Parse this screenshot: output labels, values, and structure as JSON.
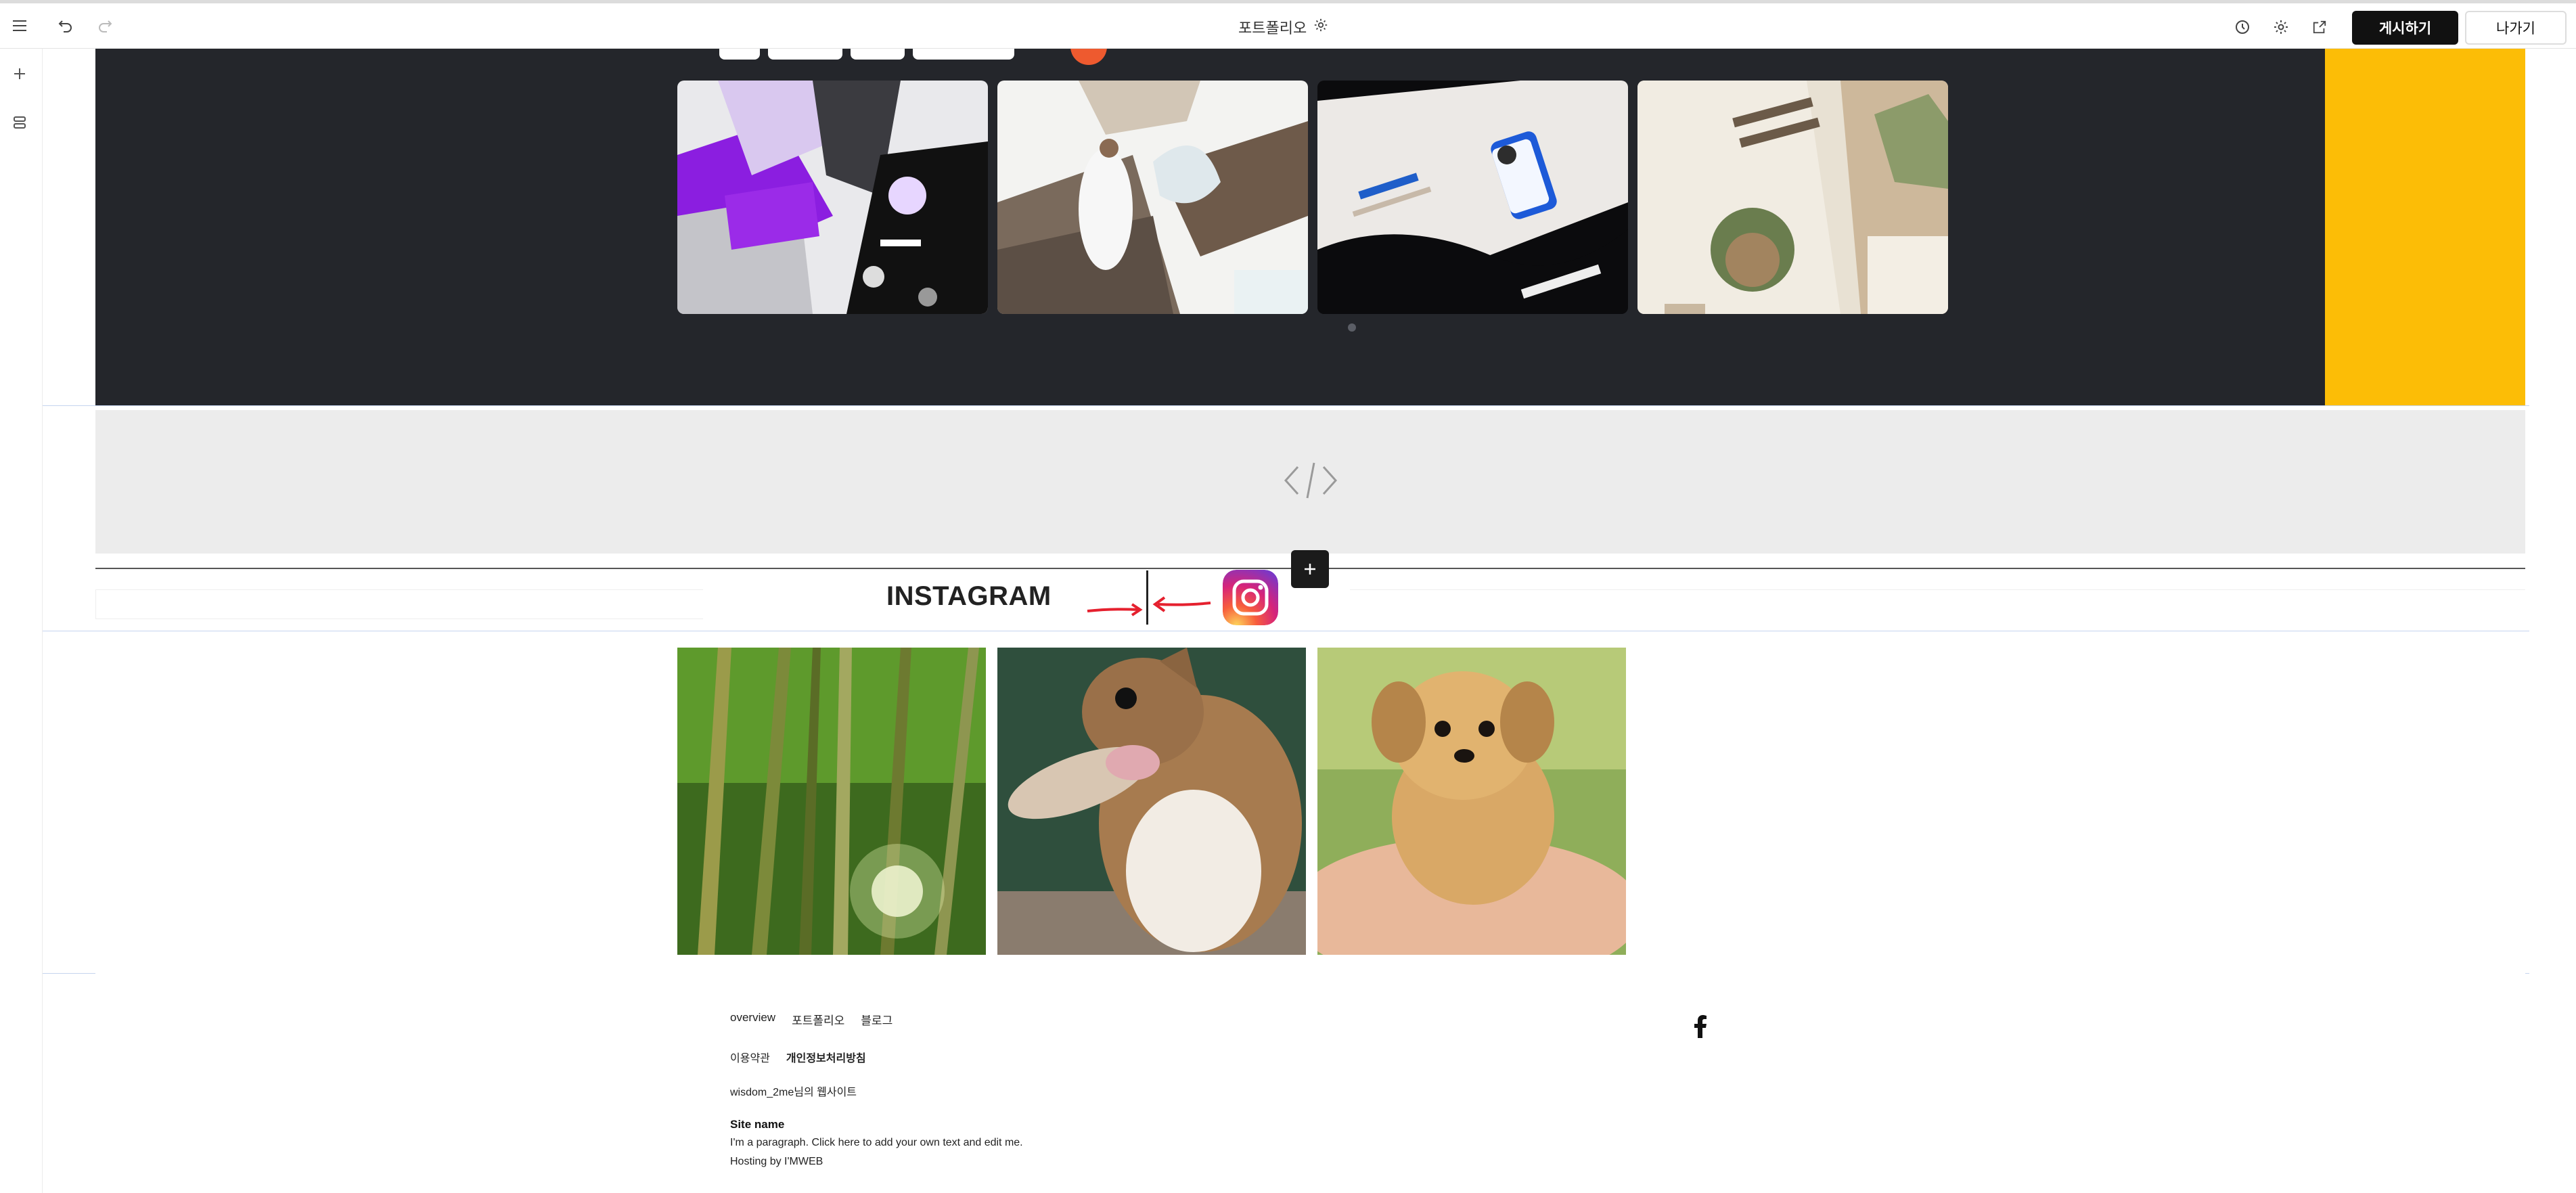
{
  "toolbar": {
    "page_title": "포트폴리오",
    "publish_label": "게시하기",
    "exit_label": "나가기"
  },
  "instagram": {
    "title": "INSTAGRAM"
  },
  "footer": {
    "nav": [
      "overview",
      "포트폴리오",
      "블로그"
    ],
    "terms": "이용약관",
    "privacy": "개인정보처리방침",
    "owner_site": "wisdom_2me님의 웹사이트",
    "site_name": "Site name",
    "paragraph": "I'm a paragraph. Click here to add your own text and edit me.",
    "hosting": "Hosting by I'MWEB"
  },
  "colors": {
    "dark_section": "#24262b",
    "yellow_accent": "#fcbd06",
    "publish_button": "#111111",
    "arrow_red": "#e5202e"
  },
  "icons": [
    "menu-icon",
    "undo-icon",
    "redo-icon",
    "settings-icon",
    "history-icon",
    "external-link-icon",
    "plus-icon",
    "layers-icon",
    "code-icon",
    "info-icon",
    "resize-icon",
    "instagram-icon",
    "facebook-icon"
  ]
}
